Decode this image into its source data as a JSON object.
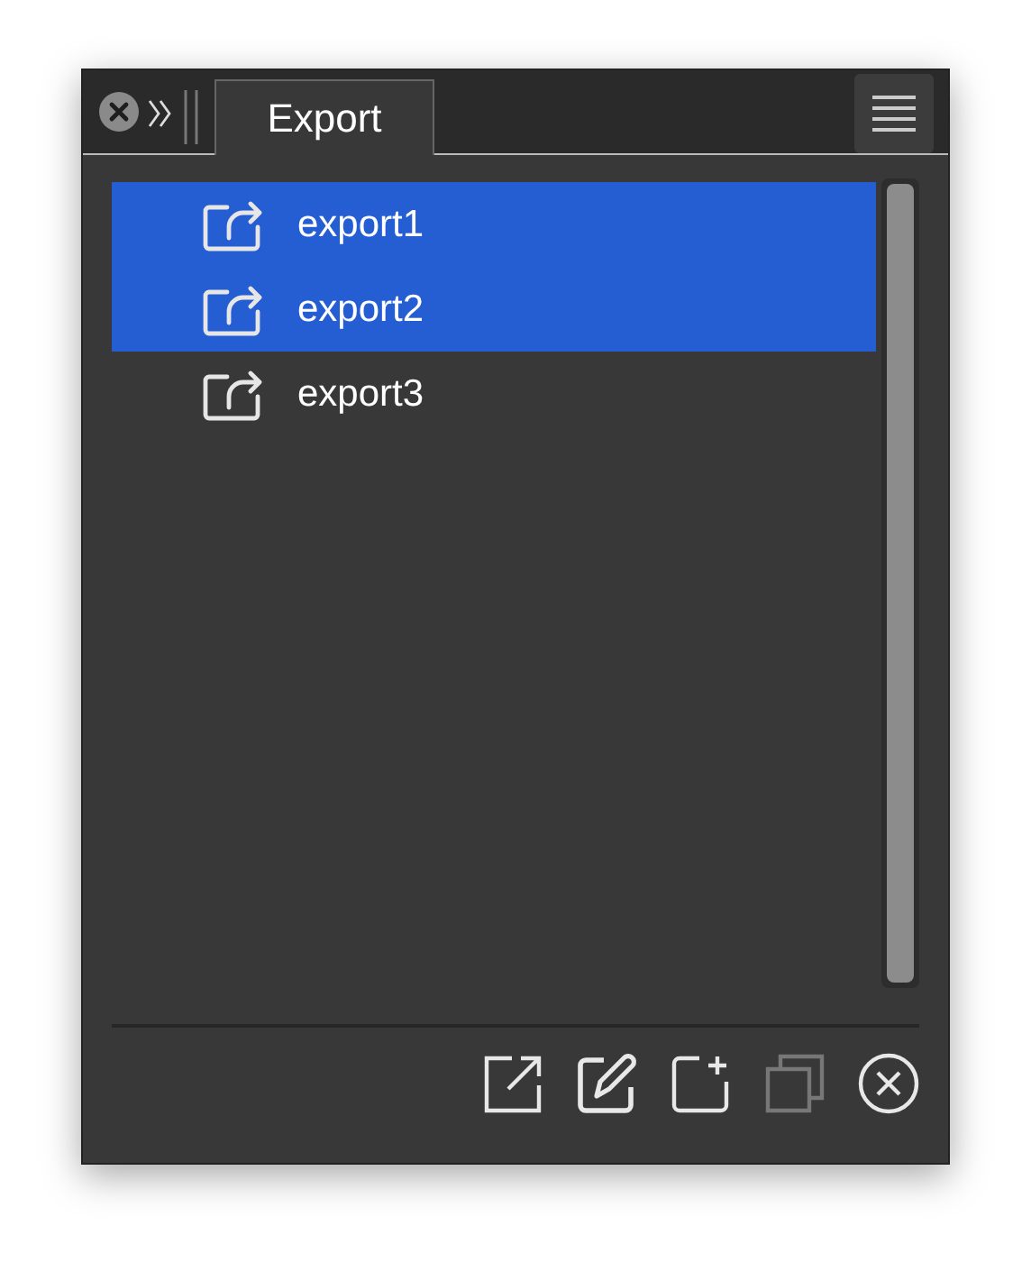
{
  "panel": {
    "tabs": [
      {
        "label": "Export",
        "selected": true
      }
    ]
  },
  "exports": [
    {
      "name": "export1",
      "selected": true
    },
    {
      "name": "export2",
      "selected": true
    },
    {
      "name": "export3",
      "selected": false
    }
  ],
  "tools": [
    {
      "kind": "export",
      "disabled": false
    },
    {
      "kind": "edit",
      "disabled": false
    },
    {
      "kind": "add",
      "disabled": false
    },
    {
      "kind": "duplicate",
      "disabled": true
    },
    {
      "kind": "delete",
      "disabled": false
    }
  ]
}
